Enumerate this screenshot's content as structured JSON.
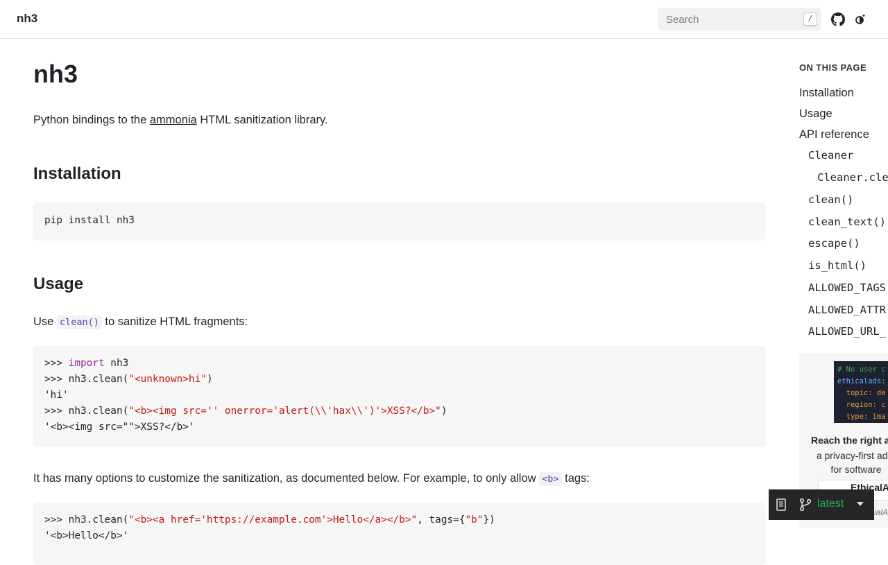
{
  "header": {
    "brand": "nh3",
    "search_placeholder": "Search",
    "search_shortcut": "/"
  },
  "page": {
    "title": "nh3",
    "intro_before": "Python bindings to the ",
    "intro_link": "ammonia",
    "intro_after": " HTML sanitization library.",
    "installation_heading": "Installation",
    "install_command": "pip install nh3",
    "usage_heading": "Usage",
    "usage_before": "Use ",
    "usage_code": "clean()",
    "usage_after": " to sanitize HTML fragments:",
    "example1": {
      "l1_prompt": ">>> ",
      "l1_kw": "import",
      "l1_rest": " nh3",
      "l2_prompt": ">>> nh3.clean(",
      "l2_str": "\"<unknown>hi\"",
      "l2_end": ")",
      "l3": "'hi'",
      "l4_prompt": ">>> nh3.clean(",
      "l4_str": "\"<b><img src='' onerror='alert(\\\\'hax\\\\')'>XSS?</b>\"",
      "l4_end": ")",
      "l5": "'<b><img src=\"\">XSS?</b>'"
    },
    "options_before": "It has many options to customize the sanitization, as documented below. For example, to only allow ",
    "options_code": "<b>",
    "options_after": " tags:",
    "example2": {
      "l1_prompt": ">>> nh3.clean(",
      "l1_str": "\"<b><a href='https://example.com'>Hello</a></b>\"",
      "l1_mid": ", tags={",
      "l1_str2": "\"b\"",
      "l1_end": "})",
      "l2": "'<b>Hello</b>'"
    }
  },
  "toc": {
    "heading": "ON THIS PAGE",
    "items": [
      "Installation",
      "Usage",
      "API reference"
    ],
    "code_items": [
      "Cleaner",
      "Cleaner.cle",
      "clean()",
      "clean_text()",
      "escape()",
      "is_html()",
      "ALLOWED_TAGS",
      "ALLOWED_ATTR",
      "ALLOWED_URL_"
    ]
  },
  "ad": {
    "code_lines": [
      "# No user c",
      "ethicalads:",
      "  topic: de",
      "  region: c",
      "  type: ima"
    ],
    "headline": "Reach the right a",
    "body_lines": [
      "a privacy-first ad n",
      "for software"
    ],
    "button": "EthicalA",
    "footer": "ialAds"
  },
  "version_badge": {
    "version": "latest"
  },
  "colors": {
    "keyword": "#a626a4",
    "string": "#c41a16",
    "version_green": "#27ae60"
  }
}
